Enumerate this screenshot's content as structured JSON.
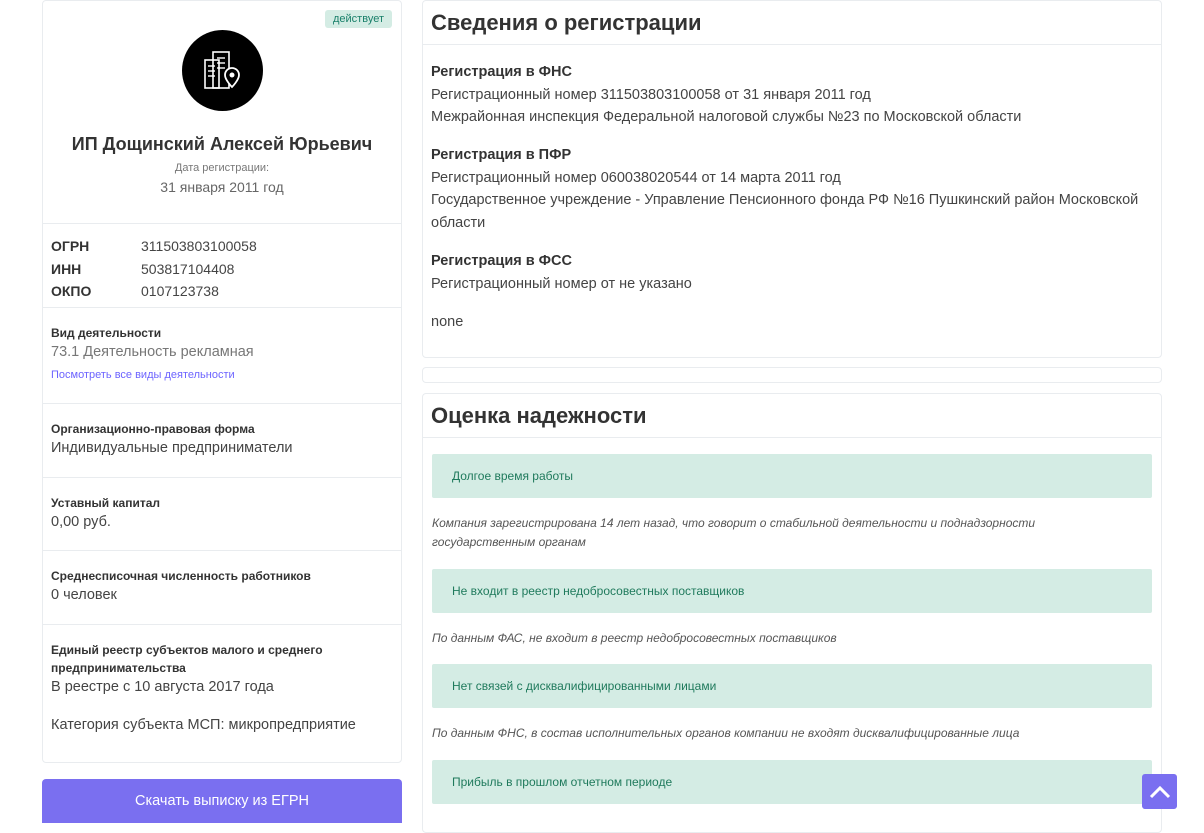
{
  "company": {
    "status": "действует",
    "name": "ИП Дощинский Алексей Юрьевич",
    "reg_date_label": "Дата регистрации:",
    "reg_date": "31 января 2011 год",
    "codes": [
      {
        "key": "ОГРН",
        "value": "311503803100058"
      },
      {
        "key": "ИНН",
        "value": "503817104408"
      },
      {
        "key": "ОКПО",
        "value": "0107123738"
      }
    ],
    "activity_label": "Вид деятельности",
    "activity_value": "73.1 Деятельность рекламная",
    "activity_link": "Посмотреть все виды деятельности",
    "legal_form_label": "Организационно-правовая форма",
    "legal_form_value": "Индивидуальные предприниматели",
    "capital_label": "Уставный капитал",
    "capital_value": "0,00 руб.",
    "employees_label": "Среднесписочная численность работников",
    "employees_value": "0 человек",
    "msp_label": "Единый реестр субъектов малого и среднего предпринимательства",
    "msp_value": "В реестре с 10 августа 2017 года",
    "msp_category": "Категория субъекта МСП: микропредприятие"
  },
  "download_button": "Скачать выписку из ЕГРН",
  "registration": {
    "title": "Сведения о регистрации",
    "fns_title": "Регистрация в ФНС",
    "fns_number": "Регистрационный номер 311503803100058 от 31 января 2011 год",
    "fns_org": "Межрайонная инспекция Федеральной налоговой службы №23 по Московской области",
    "pfr_title": "Регистрация в ПФР",
    "pfr_number": "Регистрационный номер 060038020544 от 14 марта 2011 год",
    "pfr_org": "Государственное учреждение - Управление Пенсионного фонда РФ №16 Пушкинский район Московской области",
    "fss_title": "Регистрация в ФСС",
    "fss_number": "Регистрационный номер от не указано",
    "extra": "none"
  },
  "reliability": {
    "title": "Оценка надежности",
    "items": [
      {
        "label": "Долгое время работы",
        "note": "Компания зарегистрирована 14 лет назад, что говорит о стабильной деятельности и поднадзорности государственным органам"
      },
      {
        "label": "Не входит в реестр недобросовестных поставщиков",
        "note": "По данным ФАС, не входит в реестр недобросовестных поставщиков"
      },
      {
        "label": "Нет связей с дисквалифицированными лицами",
        "note": "По данным ФНС, в состав исполнительных органов компании не входят дисквалифицированные лица"
      },
      {
        "label": "Прибыль в прошлом отчетном периоде",
        "note": ""
      }
    ]
  },
  "colors": {
    "accent": "#7a6ff0",
    "success_bg": "#d4ece4",
    "success_text": "#1f7a5c"
  },
  "icons": {
    "logo": "building-location-icon",
    "scroll_top": "chevron-up-icon"
  }
}
